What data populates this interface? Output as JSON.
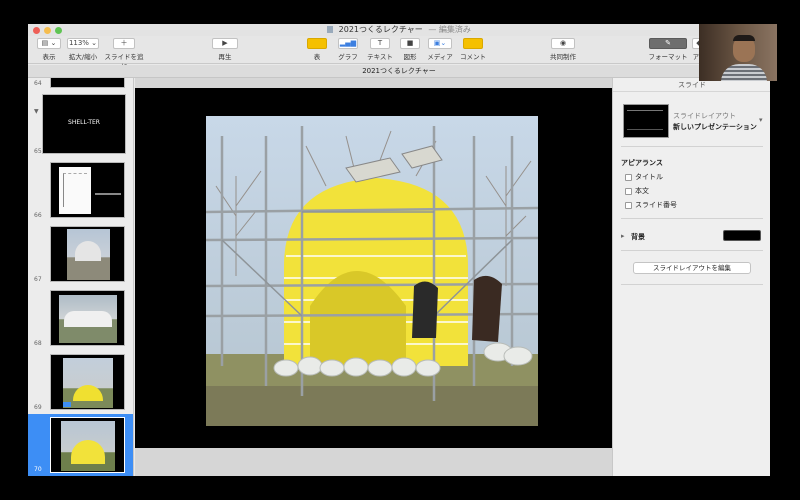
{
  "window": {
    "title": "2021つくるレクチャー",
    "title_status": "— 編集済み"
  },
  "toolbar": {
    "view_label": "表示",
    "zoom_value": "113%",
    "zoom_label": "拡大/縮小",
    "add_slide_label": "スライドを追加",
    "play_label": "再生",
    "table_label": "表",
    "chart_label": "グラフ",
    "text_label": "テキスト",
    "shape_label": "図形",
    "media_label": "メディア",
    "comment_label": "コメント",
    "collaborate_label": "共同制作",
    "format_label": "フォーマット",
    "anim_label": "アニ"
  },
  "docbar": {
    "title": "2021つくるレクチャー"
  },
  "navigator": {
    "slides": [
      {
        "number": "64",
        "caption": ""
      },
      {
        "number": "65",
        "caption": "SHELL-TER"
      },
      {
        "number": "66",
        "caption": ""
      },
      {
        "number": "67",
        "caption": ""
      },
      {
        "number": "68",
        "caption": ""
      },
      {
        "number": "69",
        "caption": ""
      },
      {
        "number": "70",
        "caption": ""
      }
    ]
  },
  "inspector": {
    "tab_label": "スライド",
    "layout_caption": "スライドレイアウト",
    "layout_name": "新しいプレゼンテーション",
    "appearance_label": "アピアランス",
    "checkboxes": [
      "タイトル",
      "本文",
      "スライド番号"
    ],
    "background_label": "背景",
    "background_color": "#000000",
    "edit_layout_button": "スライドレイアウトを編集"
  },
  "colors": {
    "selection": "#3d8ef5",
    "accent": "#f5c000",
    "dome": "#f2e23a"
  }
}
